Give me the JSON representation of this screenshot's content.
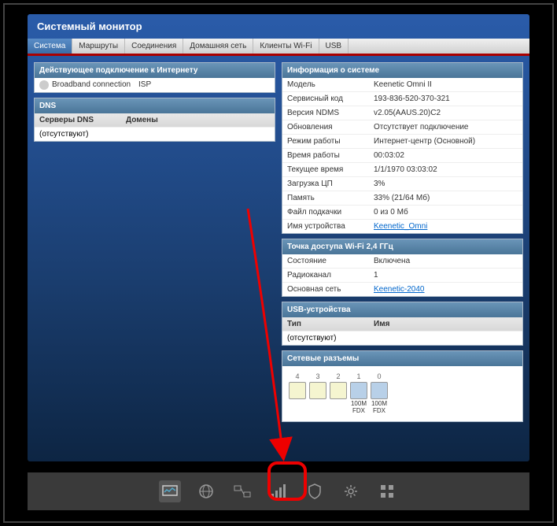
{
  "title": "Системный монитор",
  "tabs": [
    "Система",
    "Маршруты",
    "Соединения",
    "Домашняя сеть",
    "Клиенты Wi-Fi",
    "USB"
  ],
  "conn": {
    "head": "Действующее подключение к Интернету",
    "name": "Broadband connection",
    "prov": "ISP"
  },
  "dns": {
    "head": "DNS",
    "c1": "Серверы DNS",
    "c2": "Домены",
    "empty": "(отсутствуют)"
  },
  "sys": {
    "head": "Информация о системе",
    "rows": [
      {
        "l": "Модель",
        "v": "Keenetic Omni II"
      },
      {
        "l": "Сервисный код",
        "v": "193-836-520-370-321"
      },
      {
        "l": "Версия NDMS",
        "v": "v2.05(AAUS.20)C2"
      },
      {
        "l": "Обновления",
        "v": "Отсутствует подключение"
      },
      {
        "l": "Режим работы",
        "v": "Интернет-центр (Основной)"
      },
      {
        "l": "Время работы",
        "v": "00:03:02"
      },
      {
        "l": "Текущее время",
        "v": "1/1/1970 03:03:02"
      },
      {
        "l": "Загрузка ЦП",
        "v": "3%"
      },
      {
        "l": "Память",
        "v": "33% (21/64 Мб)"
      },
      {
        "l": "Файл подкачки",
        "v": "0 из 0 Мб"
      },
      {
        "l": "Имя устройства",
        "v": "Keenetic_Omni",
        "link": true
      }
    ]
  },
  "wifi": {
    "head": "Точка доступа Wi-Fi 2,4 ГГц",
    "rows": [
      {
        "l": "Состояние",
        "v": "Включена"
      },
      {
        "l": "Радиоканал",
        "v": "1"
      },
      {
        "l": "Основная сеть",
        "v": "Keenetic-2040",
        "link": true
      }
    ]
  },
  "usb": {
    "head": "USB-устройства",
    "c1": "Тип",
    "c2": "Имя",
    "empty": "(отсутствуют)"
  },
  "ports": {
    "head": "Сетевые разъемы",
    "items": [
      {
        "n": "4",
        "c": "y"
      },
      {
        "n": "3",
        "c": "y"
      },
      {
        "n": "2",
        "c": "y"
      },
      {
        "n": "1",
        "c": "b",
        "s": "100M",
        "d": "FDX"
      },
      {
        "n": "0",
        "c": "b",
        "s": "100M",
        "d": "FDX"
      }
    ]
  }
}
